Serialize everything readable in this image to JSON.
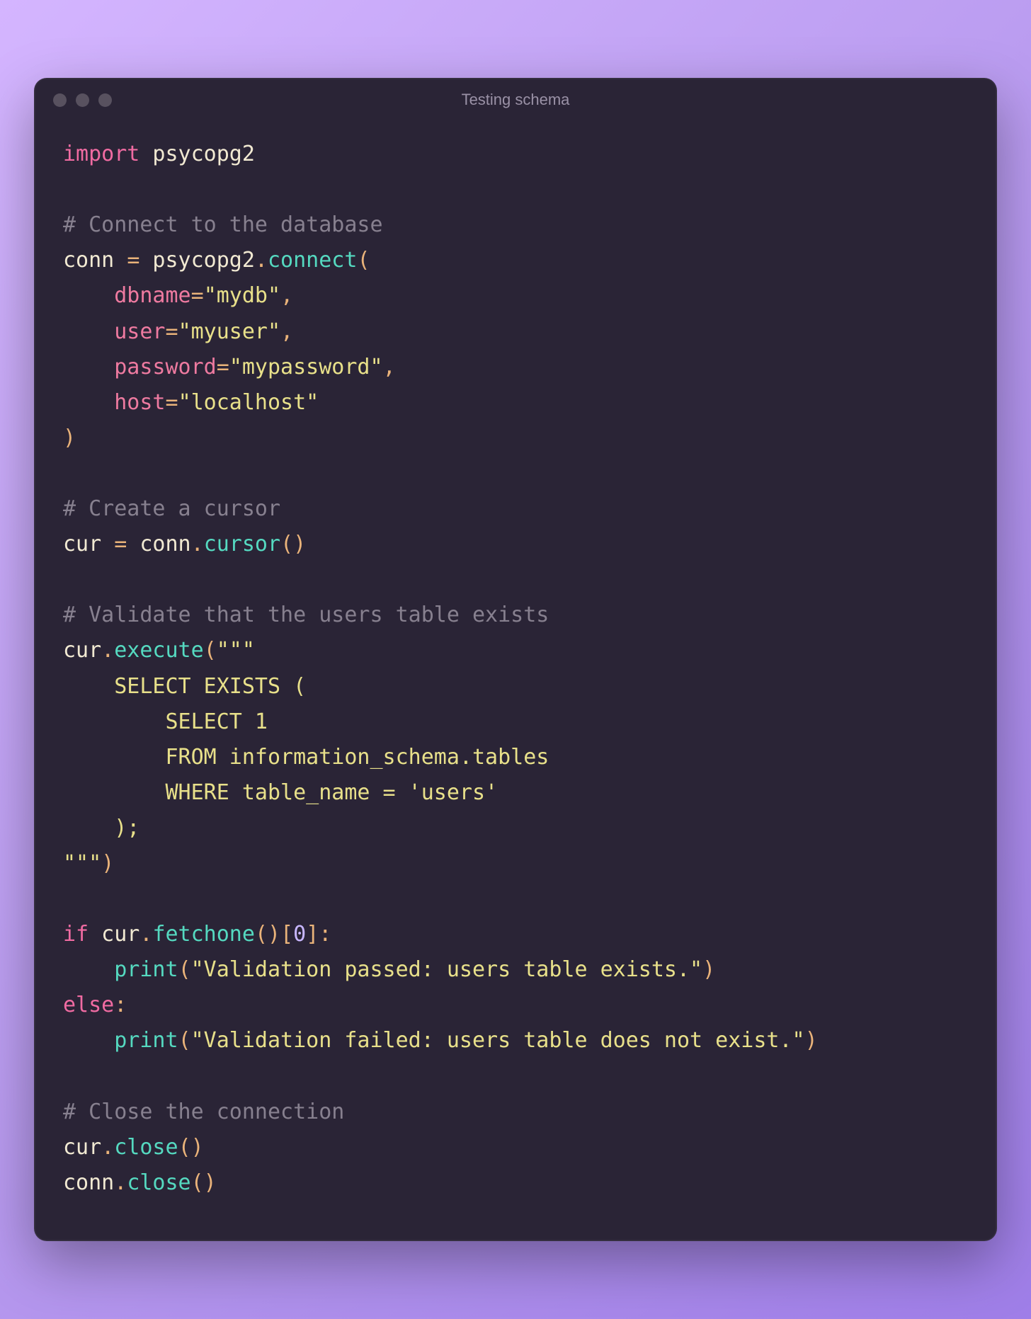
{
  "window": {
    "title": "Testing schema"
  },
  "code": {
    "l01_import": "import",
    "l01_mod": " psycopg2",
    "l03_comment": "# Connect to the database",
    "l04_a": "conn ",
    "l04_eq": "=",
    "l04_b": " psycopg2",
    "l04_dot": ".",
    "l04_fn": "connect",
    "l04_open": "(",
    "l05_indent": "    ",
    "l05_kw": "dbname",
    "l05_eq": "=",
    "l05_str": "\"mydb\"",
    "l05_comma": ",",
    "l06_kw": "user",
    "l06_str": "\"myuser\"",
    "l07_kw": "password",
    "l07_str": "\"mypassword\"",
    "l08_kw": "host",
    "l08_str": "\"localhost\"",
    "l09_close": ")",
    "l11_comment": "# Create a cursor",
    "l12_a": "cur ",
    "l12_b": " conn",
    "l12_fn": "cursor",
    "l12_paren": "()",
    "l14_comment": "# Validate that the users table exists",
    "l15_a": "cur",
    "l15_fn": "execute",
    "l15_open": "(",
    "l15_tq": "\"\"\"",
    "l16": "    SELECT EXISTS (",
    "l17": "        SELECT 1",
    "l18": "        FROM information_schema.tables",
    "l19": "        WHERE table_name = 'users'",
    "l20": "    );",
    "l21_tq": "\"\"\"",
    "l21_close": ")",
    "l23_if": "if",
    "l23_a": " cur",
    "l23_fn": "fetchone",
    "l23_paren": "()",
    "l23_br_open": "[",
    "l23_idx": "0",
    "l23_br_close": "]",
    "l23_colon": ":",
    "l24_indent": "    ",
    "l24_fn": "print",
    "l24_open": "(",
    "l24_str": "\"Validation passed: users table exists.\"",
    "l24_close": ")",
    "l25_else": "else",
    "l25_colon": ":",
    "l26_fn": "print",
    "l26_str": "\"Validation failed: users table does not exist.\"",
    "l28_comment": "# Close the connection",
    "l29_a": "cur",
    "l29_fn": "close",
    "l30_a": "conn",
    "l30_fn": "close"
  }
}
